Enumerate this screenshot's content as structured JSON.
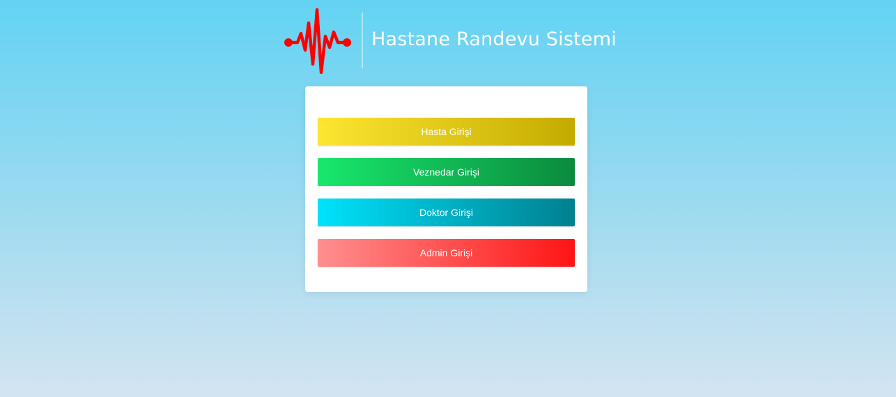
{
  "header": {
    "title": "Hastane Randevu Sistemi",
    "logo_icon": "heartbeat-icon",
    "logo_color": "#ff0000"
  },
  "login": {
    "buttons": [
      {
        "label": "Hasta Girişi",
        "colors": [
          "#fde631",
          "#c4ab00"
        ]
      },
      {
        "label": "Veznedar Girişi",
        "colors": [
          "#18e86d",
          "#0b8a3d"
        ]
      },
      {
        "label": "Doktor Girişi",
        "colors": [
          "#00e2fc",
          "#00808f"
        ]
      },
      {
        "label": "Admin Girişi",
        "colors": [
          "#ff8f8f",
          "#ff1414"
        ]
      }
    ]
  }
}
